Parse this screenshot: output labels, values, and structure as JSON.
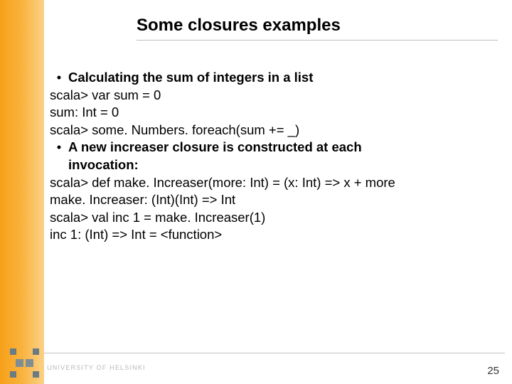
{
  "title": "Some closures examples",
  "bullet1": "Calculating the sum of integers in a list",
  "line1": "scala> var sum = 0",
  "line2": "sum: Int = 0",
  "line3": "scala> some. Numbers. foreach(sum += _)",
  "bullet2_a": "A new increaser closure is constructed at each",
  "bullet2_b": "invocation:",
  "line4": "scala> def make. Increaser(more: Int) = (x: Int) => x + more",
  "line5": "make. Increaser: (Int)(Int) => Int",
  "line6": "scala> val inc 1 = make. Increaser(1)",
  "line7": "inc 1: (Int) => Int = <function>",
  "page_number": "25",
  "university": "UNIVERSITY OF HELSINKI"
}
